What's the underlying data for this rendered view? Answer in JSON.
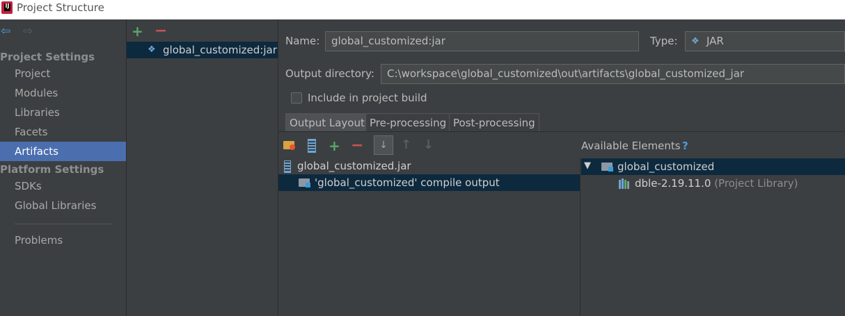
{
  "window": {
    "title": "Project Structure",
    "logo_text": "IJ"
  },
  "sidebar": {
    "project_settings_header": "Project Settings",
    "project_settings_items": [
      {
        "label": "Project"
      },
      {
        "label": "Modules"
      },
      {
        "label": "Libraries"
      },
      {
        "label": "Facets"
      },
      {
        "label": "Artifacts",
        "selected": true
      }
    ],
    "platform_settings_header": "Platform Settings",
    "platform_settings_items": [
      {
        "label": "SDKs"
      },
      {
        "label": "Global Libraries"
      }
    ],
    "problems_label": "Problems"
  },
  "artifacts": {
    "add_icon": "+",
    "remove_icon": "−",
    "items": [
      {
        "label": "global_customized:jar",
        "selected": true
      }
    ]
  },
  "form": {
    "name_label": "Name:",
    "name_value": "global_customized:jar",
    "type_label": "Type:",
    "type_value": "JAR",
    "output_dir_label": "Output directory:",
    "output_dir_value": "C:\\workspace\\global_customized\\out\\artifacts\\global_customized_jar",
    "include_build_label": "Include in project build",
    "include_build_checked": false
  },
  "tabs": [
    {
      "label": "Output Layout",
      "active": true
    },
    {
      "label": "Pre-processing"
    },
    {
      "label": "Post-processing"
    }
  ],
  "layout_toolbar": {
    "add_icon": "+",
    "remove_icon": "−",
    "up_icon": "↑",
    "down_icon": "↓",
    "sort_icon": "↓"
  },
  "output_layout": {
    "root": "global_customized.jar",
    "children": [
      {
        "label": "'global_customized' compile output",
        "selected": true
      }
    ]
  },
  "available": {
    "title": "Available Elements",
    "help_icon": "?",
    "expand_icon": "▼",
    "module": "global_customized",
    "library_name": "dble-2.19.11.0",
    "library_note": "(Project Library)"
  },
  "colors": {
    "background": "#3c3f41",
    "selection": "#4b6eaf",
    "tree_selection": "#0d293e",
    "add_green": "#59a869",
    "remove_red": "#c75450"
  }
}
